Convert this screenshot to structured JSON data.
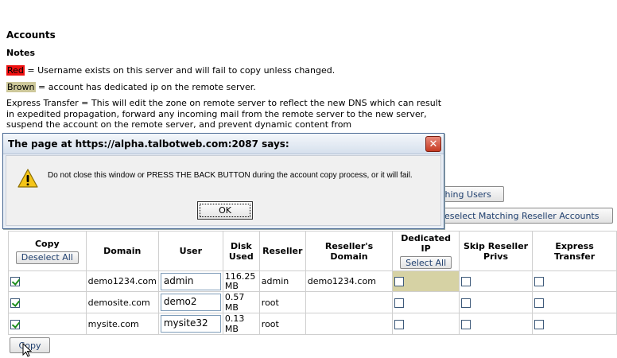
{
  "page": {
    "heading": "Accounts",
    "notes_heading": "Notes",
    "note_red_swatch": "Red",
    "note_red_text": " = Username exists on this server and will fail to copy unless changed.",
    "note_brown_swatch": "Brown",
    "note_brown_text": " = account has dedicated ip on the remote server.",
    "express_text": "Express Transfer = This will edit the zone on remote server to reflect the new DNS which can result in expedited propagation, forward any incoming mail from the remote server to the new server, suspend the account on the remote server, and prevent dynamic content from"
  },
  "buttons": {
    "matching_users": "tching Users",
    "deselect_matching_reseller": "Deselect Matching Reseller Accounts",
    "copy": "Copy"
  },
  "dialog": {
    "title": "The page at https://alpha.talbotweb.com:2087 says:",
    "message": "Do not close this window or PRESS THE BACK BUTTON during the account copy process, or it will fail.",
    "ok_label": "OK",
    "close_glyph": "✕"
  },
  "table": {
    "headers": {
      "copy": "Copy",
      "deselect_all": "Deselect All",
      "domain": "Domain",
      "user": "User",
      "disk_used": "Disk Used",
      "reseller": "Reseller",
      "resellers_domain": "Reseller's Domain",
      "dedicated_ip": "Dedicated IP",
      "select_all": "Select All",
      "skip_reseller_privs": "Skip Reseller Privs",
      "express_transfer": "Express Transfer"
    },
    "rows": [
      {
        "copy": true,
        "domain": "demo1234.com",
        "user": "admin",
        "disk": "116.25 MB",
        "reseller": "admin",
        "reseller_domain": "demo1234.com",
        "dedicated": false,
        "skip": false,
        "express": false
      },
      {
        "copy": true,
        "domain": "demosite.com",
        "user": "demo2",
        "disk": "0.57 MB",
        "reseller": "root",
        "reseller_domain": "",
        "dedicated": false,
        "skip": false,
        "express": false
      },
      {
        "copy": true,
        "domain": "mysite.com",
        "user": "mysite32",
        "disk": "0.13 MB",
        "reseller": "root",
        "reseller_domain": "",
        "dedicated": false,
        "skip": false,
        "express": false
      }
    ]
  },
  "colors": {
    "red_note": "#ee1111",
    "brown_note": "#cdc89a",
    "dialog_border": "#4b6a94",
    "button_text": "#1f3f6e"
  }
}
